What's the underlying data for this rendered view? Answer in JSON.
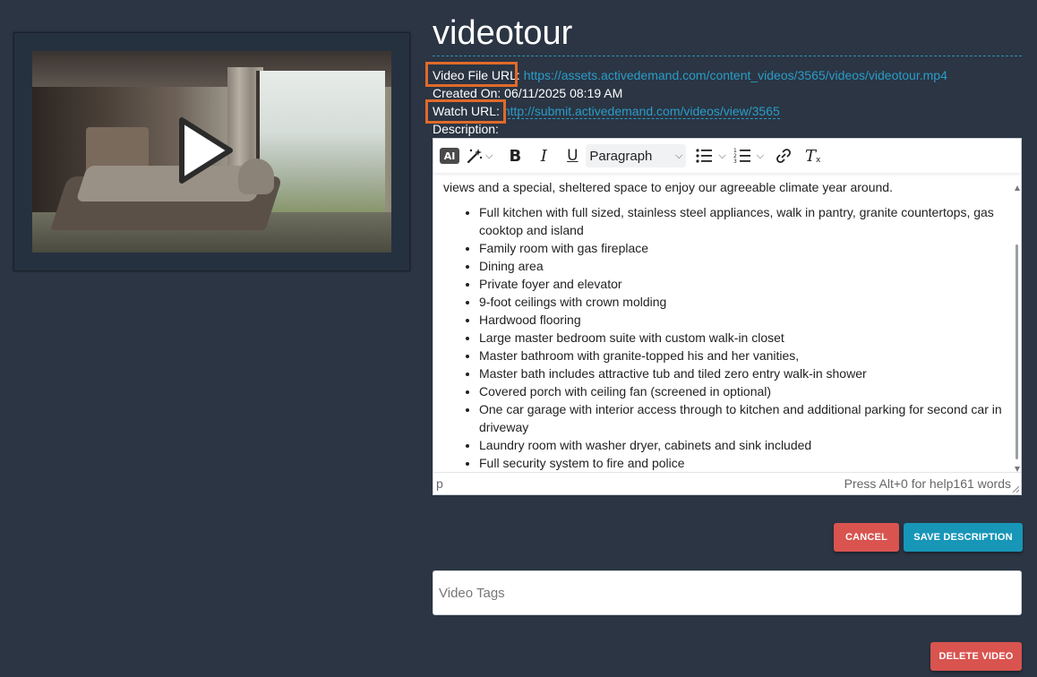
{
  "video": {
    "title": "videotour",
    "file_url_label": "Video File URL:",
    "file_url": "https://assets.activedemand.com/content_videos/3565/videos/videotour.mp4",
    "created_on_label": "Created On:",
    "created_on": "06/11/2025 08:19 AM",
    "watch_url_label": "Watch URL:",
    "watch_url": "http://submit.activedemand.com/videos/view/3565",
    "description_label": "Description:"
  },
  "editor": {
    "toolbar": {
      "ai_label": "AI",
      "block_format": "Paragraph",
      "icons": [
        "ai-icon",
        "magic-wand-icon",
        "bold-icon",
        "italic-icon",
        "underline-icon",
        "bullet-list-icon",
        "numbered-list-icon",
        "link-icon",
        "clear-format-icon"
      ]
    },
    "intro_text": "views and a special, sheltered space to enjoy our agreeable climate year around.",
    "list_items": [
      "Full kitchen with full sized, stainless steel appliances, walk in pantry, granite countertops, gas cooktop and island",
      "Family room with gas fireplace",
      "Dining area",
      "Private foyer and elevator",
      "9-foot ceilings with crown molding",
      "Hardwood flooring",
      "Large master bedroom suite with custom walk-in closet",
      "Master bathroom with granite-topped his and her vanities,",
      "Master bath includes attractive tub and tiled zero entry walk-in shower",
      "Covered porch with ceiling fan (screened in optional)",
      "One car garage with interior access through to kitchen and additional parking for second car in driveway",
      "Laundry room with washer dryer, cabinets and sink included",
      "Full security system to fire and police"
    ],
    "status_path": "p",
    "status_help": "Press Alt+0 for help",
    "word_count": "161 words"
  },
  "buttons": {
    "cancel": "CANCEL",
    "save": "SAVE DESCRIPTION",
    "delete": "DELETE VIDEO"
  },
  "tags": {
    "placeholder": "Video Tags"
  },
  "colors": {
    "background": "#2b3543",
    "link": "#2a9cc8",
    "highlight": "#e06a2a",
    "danger": "#d9534f",
    "primary": "#1796b8"
  }
}
